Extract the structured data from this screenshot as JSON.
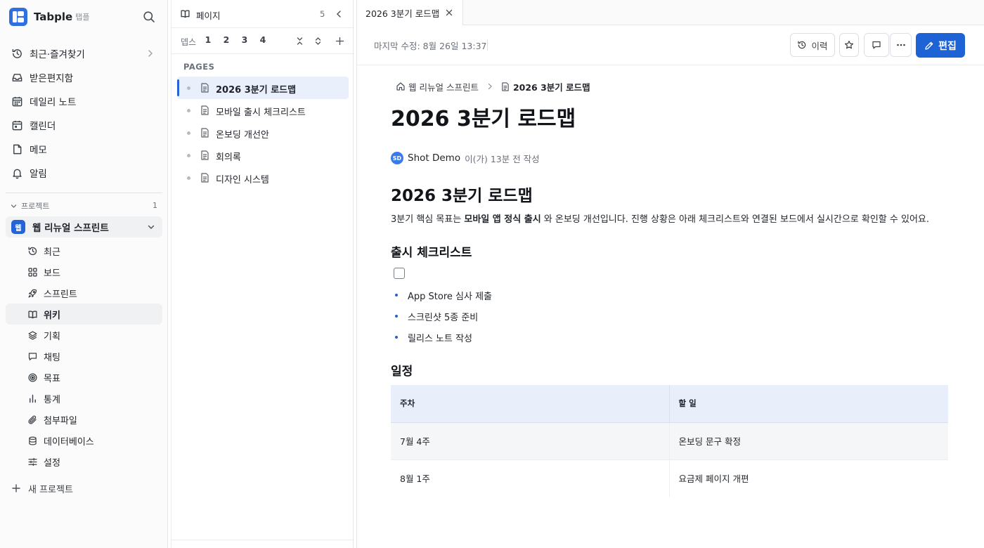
{
  "app": {
    "name": "Tabple",
    "sub_name": "탭플"
  },
  "sidebar": {
    "main_nav": [
      {
        "label": "최근·즐겨찾기",
        "icon": "history-icon",
        "has_chevron": true
      },
      {
        "label": "받은편지함",
        "icon": "inbox-icon"
      },
      {
        "label": "데일리 노트",
        "icon": "calendar-grid-icon"
      },
      {
        "label": "캘린더",
        "icon": "calendar-icon"
      },
      {
        "label": "메모",
        "icon": "note-icon"
      },
      {
        "label": "알림",
        "icon": "bell-icon"
      }
    ],
    "projects_header": "프로젝트",
    "projects_count": "1",
    "project": {
      "badge": "웹",
      "name": "웹 리뉴얼 스프린트"
    },
    "project_nav": [
      {
        "label": "최근",
        "icon": "history-icon"
      },
      {
        "label": "보드",
        "icon": "board-icon"
      },
      {
        "label": "스프린트",
        "icon": "rocket-icon"
      },
      {
        "label": "위키",
        "icon": "book-open-icon",
        "active": true
      },
      {
        "label": "기획",
        "icon": "layers-icon"
      },
      {
        "label": "채팅",
        "icon": "chat-icon"
      },
      {
        "label": "목표",
        "icon": "target-icon"
      },
      {
        "label": "통계",
        "icon": "bar-chart-icon"
      },
      {
        "label": "첨부파일",
        "icon": "paperclip-icon"
      },
      {
        "label": "데이터베이스",
        "icon": "database-icon"
      },
      {
        "label": "설정",
        "icon": "sliders-icon"
      }
    ],
    "new_project_label": "새 프로젝트"
  },
  "pages_panel": {
    "title": "페이지",
    "count": "5",
    "depth_label": "뎁스",
    "depth_levels": [
      "1",
      "2",
      "3",
      "4"
    ],
    "section_label": "PAGES",
    "items": [
      {
        "label": "2026 3분기 로드맵",
        "active": true
      },
      {
        "label": "모바일 출시 체크리스트"
      },
      {
        "label": "온보딩 개선안"
      },
      {
        "label": "회의록"
      },
      {
        "label": "디자인 시스템"
      }
    ]
  },
  "tabs": [
    {
      "label": "2026 3분기 로드맵"
    }
  ],
  "toolbar": {
    "last_edited": "마지막 수정: 8월 26일 13:37",
    "history_label": "이력",
    "edit_label": "편집"
  },
  "document": {
    "breadcrumb_parent": "웹 리뉴얼 스프린트",
    "breadcrumb_current": "2026 3분기 로드맵",
    "title": "2026 3분기 로드맵",
    "author_initials": "SD",
    "author_name": "Shot Demo",
    "author_meta": "이(가) 13분 전 작성",
    "heading": "2026 3분기 로드맵",
    "paragraph_before": "3분기 핵심 목표는 ",
    "paragraph_bold": "모바일 앱 정식 출시",
    "paragraph_after": " 와 온보딩 개선입니다. 진행 상황은 아래 체크리스트와 연결된 보드에서 실시간으로 확인할 수 있어요.",
    "checklist_heading": "출시 체크리스트",
    "checklist_items": [
      "App Store 심사 제출",
      "스크린샷 5종 준비",
      "릴리스 노트 작성"
    ],
    "schedule_heading": "일정",
    "schedule_columns": [
      "주차",
      "할 일"
    ],
    "schedule_rows": [
      [
        "7월 4주",
        "온보딩 문구 확정"
      ],
      [
        "8월 1주",
        "요금제 페이지 개편"
      ]
    ]
  }
}
